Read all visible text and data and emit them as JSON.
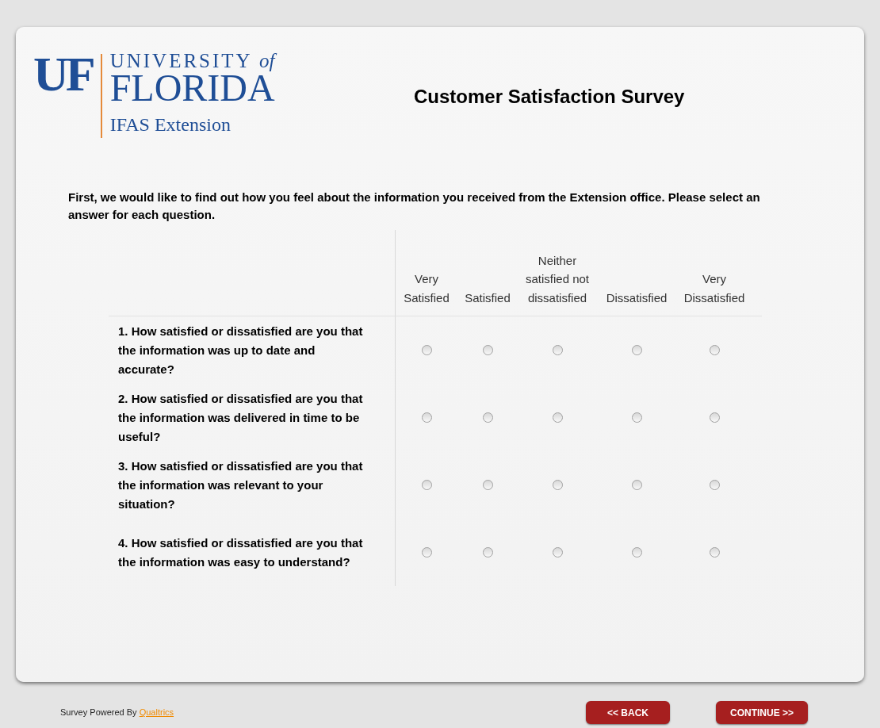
{
  "logo": {
    "mark": "UF",
    "line1": "UNIVERSITY",
    "line1_italic": "of",
    "line2": "FLORIDA",
    "line3": "IFAS Extension"
  },
  "title": "Customer Satisfaction Survey",
  "intro": "First, we would like to find out how you feel about the information you received from the Extension office.  Please select an answer for each question.",
  "columns": [
    "Very Satisfied",
    "Satisfied",
    "Neither satisfied not dissatisfied",
    "Dissatisfied",
    "Very Dissatisfied"
  ],
  "questions": [
    {
      "text": "1. How satisfied or dissatisfied are you that the information was up to date and accurate?",
      "options": [
        {
          "selected": false
        },
        {
          "selected": false
        },
        {
          "selected": false
        },
        {
          "selected": false
        },
        {
          "selected": false
        }
      ]
    },
    {
      "text": "2. How satisfied or dissatisfied are you that the information was delivered in time to be useful?",
      "options": [
        {
          "selected": false
        },
        {
          "selected": false
        },
        {
          "selected": false
        },
        {
          "selected": false
        },
        {
          "selected": false
        }
      ]
    },
    {
      "text": "3. How satisfied or dissatisfied are you that the information was relevant to your situation?",
      "options": [
        {
          "selected": false
        },
        {
          "selected": false
        },
        {
          "selected": false
        },
        {
          "selected": false
        },
        {
          "selected": false
        }
      ]
    },
    {
      "text": "4. How satisfied or dissatisfied are you that the information was easy to understand?",
      "options": [
        {
          "selected": false
        },
        {
          "selected": false
        },
        {
          "selected": false
        },
        {
          "selected": false
        },
        {
          "selected": false
        }
      ]
    }
  ],
  "footer": {
    "powered_by": "Survey Powered By",
    "link": "Qualtrics"
  },
  "buttons": [
    "<< BACK",
    "CONTINUE >>"
  ]
}
